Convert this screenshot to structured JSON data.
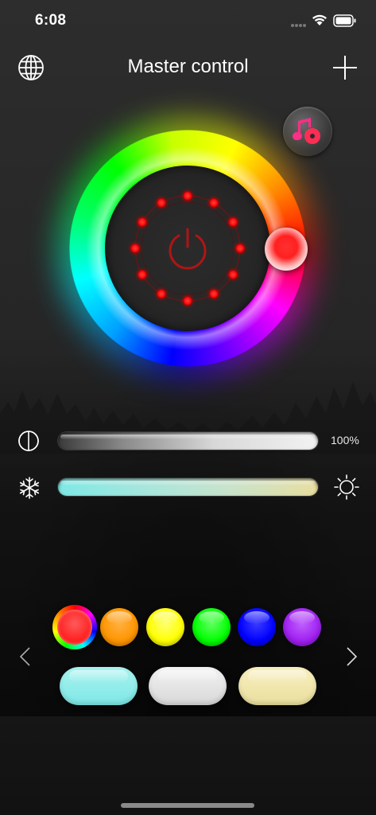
{
  "status_bar": {
    "time": "6:08"
  },
  "header": {
    "title": "Master control",
    "left_icon": "globe-icon",
    "right_icon": "plus-icon"
  },
  "music_button": {
    "icon": "music-note-icon",
    "accent_color": "#ff2d6f"
  },
  "color_wheel": {
    "selected_color": "#ff2020",
    "center_icon": "power-icon",
    "led_color": "#ff1a1a"
  },
  "brightness": {
    "icon": "contrast-icon",
    "value_text": "100%",
    "level": 1.0
  },
  "color_temperature": {
    "left_icon": "snowflake-icon",
    "right_icon": "sun-icon",
    "gradient": [
      "#7ee9e6",
      "#e8dea0"
    ]
  },
  "color_presets": {
    "selected_index": 0,
    "colors": [
      "#ff2020",
      "#ff9500",
      "#ffff00",
      "#00ff00",
      "#0000ff",
      "#a020f0"
    ],
    "white_presets": [
      "#7ee8e6",
      "#e2e2e2",
      "#efe3a5"
    ],
    "prev_icon": "chevron-left-icon",
    "next_icon": "chevron-right-icon"
  }
}
